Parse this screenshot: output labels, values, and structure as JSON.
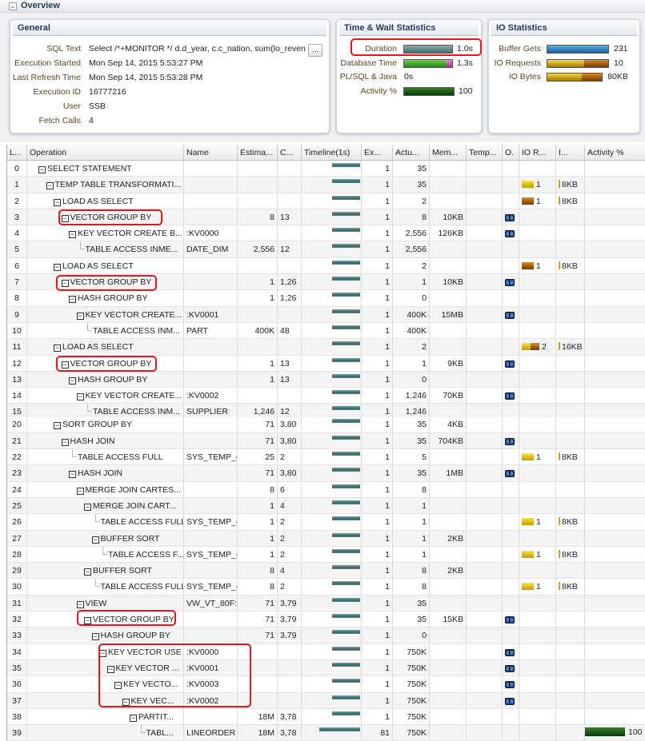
{
  "overview": {
    "title": "Overview"
  },
  "general": {
    "title": "General",
    "more_label": "...",
    "fields": [
      {
        "label": "SQL Text",
        "value": "Select /*+MONITOR */ d.d_year, c.c_nation, sum(lo_reven"
      },
      {
        "label": "Execution Started",
        "value": "Mon Sep 14, 2015 5:53:27 PM"
      },
      {
        "label": "Last Refresh Time",
        "value": "Mon Sep 14, 2015 5:53:28 PM"
      },
      {
        "label": "Execution ID",
        "value": "16777216"
      },
      {
        "label": "User",
        "value": "SSB"
      },
      {
        "label": "Fetch Calls",
        "value": "4"
      }
    ]
  },
  "time_wait": {
    "title": "Time & Wait Statistics",
    "stats": [
      {
        "label": "Duration",
        "value": "1.0s",
        "bar": 1.0
      },
      {
        "label": "Database Time",
        "value": "1.3s",
        "bar": 1.0
      },
      {
        "label": "PL/SQL & Java",
        "value": "0s",
        "bar": 0
      },
      {
        "label": "Activity %",
        "value": "100",
        "bar": 1.0
      }
    ]
  },
  "io": {
    "title": "IO Statistics",
    "stats": [
      {
        "label": "Buffer Gets",
        "value": "231",
        "bar": 1.0
      },
      {
        "label": "IO Requests",
        "value": "10",
        "bar": 1.0
      },
      {
        "label": "IO Bytes",
        "value": "80KB",
        "bar": 0.9
      }
    ]
  },
  "colors": {
    "highlight": "#e8161b",
    "timeline": "#356565",
    "activity": "#0a3a0a"
  },
  "columns": [
    "L...",
    "Operation",
    "Name",
    "Estima...",
    "C...",
    "Timeline(1s)",
    "Ex...",
    "Actu...",
    "Mem...",
    "Temp...",
    "O.",
    "IO R...",
    "I...",
    "Activity %"
  ],
  "rows": [
    {
      "id": "0",
      "lvl": 0,
      "op": "SELECT STATEMENT",
      "name": "",
      "est": "",
      "cost": "",
      "ex": "1",
      "act": "35",
      "mem": "",
      "bino": false,
      "io": "",
      "iot": "",
      "ib": ""
    },
    {
      "id": "1",
      "lvl": 1,
      "op": "TEMP TABLE TRANSFORMATI...",
      "name": "",
      "est": "",
      "cost": "",
      "ex": "1",
      "act": "35",
      "mem": "",
      "bino": false,
      "io": "1",
      "iot": "y",
      "ib": "8KB"
    },
    {
      "id": "2",
      "lvl": 2,
      "op": "LOAD AS SELECT",
      "name": "",
      "est": "",
      "cost": "",
      "ex": "1",
      "act": "2",
      "mem": "",
      "bino": false,
      "io": "1",
      "iot": "b",
      "ib": "8KB"
    },
    {
      "id": "3",
      "lvl": 3,
      "op": "VECTOR GROUP BY",
      "name": "",
      "est": "8",
      "cost": "13",
      "ex": "1",
      "act": "8",
      "mem": "10KB",
      "bino": true,
      "io": "",
      "iot": "",
      "ib": ""
    },
    {
      "id": "4",
      "lvl": 4,
      "op": "KEY VECTOR CREATE B...",
      "name": ":KV0000",
      "est": "",
      "cost": "",
      "ex": "1",
      "act": "2,556",
      "mem": "126KB",
      "bino": true,
      "io": "",
      "iot": "",
      "ib": ""
    },
    {
      "id": "5",
      "lvl": 5,
      "leaf": true,
      "op": "TABLE ACCESS INME...",
      "name": "DATE_DIM",
      "est": "2,556",
      "cost": "12",
      "ex": "1",
      "act": "2,556",
      "mem": "",
      "bino": false,
      "io": "",
      "iot": "",
      "ib": ""
    },
    {
      "id": "6",
      "lvl": 2,
      "op": "LOAD AS SELECT",
      "name": "",
      "est": "",
      "cost": "",
      "ex": "1",
      "act": "2",
      "mem": "",
      "bino": false,
      "io": "1",
      "iot": "b",
      "ib": "8KB"
    },
    {
      "id": "7",
      "lvl": 3,
      "op": "VECTOR GROUP BY",
      "name": "",
      "est": "1",
      "cost": "1,26",
      "ex": "1",
      "act": "1",
      "mem": "10KB",
      "bino": true,
      "io": "",
      "iot": "",
      "ib": ""
    },
    {
      "id": "8",
      "lvl": 4,
      "op": "HASH GROUP BY",
      "name": "",
      "est": "1",
      "cost": "1,26",
      "ex": "1",
      "act": "0",
      "mem": "",
      "bino": false,
      "io": "",
      "iot": "",
      "ib": ""
    },
    {
      "id": "9",
      "lvl": 5,
      "op": "KEY VECTOR CREATE...",
      "name": ":KV0001",
      "est": "",
      "cost": "",
      "ex": "1",
      "act": "400K",
      "mem": "15MB",
      "bino": true,
      "io": "",
      "iot": "",
      "ib": ""
    },
    {
      "id": "10",
      "lvl": 6,
      "leaf": true,
      "op": "TABLE ACCESS INM...",
      "name": "PART",
      "est": "400K",
      "cost": "48",
      "ex": "1",
      "act": "400K",
      "mem": "",
      "bino": false,
      "io": "",
      "iot": "",
      "ib": ""
    },
    {
      "id": "11",
      "lvl": 2,
      "op": "LOAD AS SELECT",
      "name": "",
      "est": "",
      "cost": "",
      "ex": "1",
      "act": "2",
      "mem": "",
      "bino": false,
      "io": "2",
      "iot": "yb",
      "ib": "16KB"
    },
    {
      "id": "12",
      "lvl": 3,
      "op": "VECTOR GROUP BY",
      "name": "",
      "est": "1",
      "cost": "13",
      "ex": "1",
      "act": "1",
      "mem": "9KB",
      "bino": true,
      "io": "",
      "iot": "",
      "ib": ""
    },
    {
      "id": "13",
      "lvl": 4,
      "op": "HASH GROUP BY",
      "name": "",
      "est": "1",
      "cost": "13",
      "ex": "1",
      "act": "0",
      "mem": "",
      "bino": false,
      "io": "",
      "iot": "",
      "ib": ""
    },
    {
      "id": "14",
      "lvl": 5,
      "op": "KEY VECTOR CREATE...",
      "name": ":KV0002",
      "est": "",
      "cost": "",
      "ex": "1",
      "act": "1,246",
      "mem": "70KB",
      "bino": true,
      "io": "",
      "iot": "",
      "ib": ""
    },
    {
      "id": "15",
      "lvl": 6,
      "leaf": true,
      "cut": true,
      "op": "TABLE ACCESS INM...",
      "name": "SUPPLIER",
      "est": "1,246",
      "cost": "12",
      "ex": "1",
      "act": "1,246",
      "mem": "",
      "bino": false,
      "io": "",
      "iot": "",
      "ib": ""
    },
    {
      "id": "20",
      "lvl": 2,
      "op": "SORT GROUP BY",
      "name": "",
      "est": "71",
      "cost": "3,80",
      "ex": "1",
      "act": "35",
      "mem": "4KB",
      "bino": false,
      "io": "",
      "iot": "",
      "ib": ""
    },
    {
      "id": "21",
      "lvl": 3,
      "op": "HASH JOIN",
      "name": "",
      "est": "71",
      "cost": "3,80",
      "ex": "1",
      "act": "35",
      "mem": "704KB",
      "bino": true,
      "io": "",
      "iot": "",
      "ib": ""
    },
    {
      "id": "22",
      "lvl": 4,
      "leaf": true,
      "op": "TABLE ACCESS FULL",
      "name": "SYS_TEMP_(",
      "est": "25",
      "cost": "2",
      "ex": "1",
      "act": "5",
      "mem": "",
      "bino": false,
      "io": "1",
      "iot": "y",
      "ib": "8KB"
    },
    {
      "id": "23",
      "lvl": 4,
      "op": "HASH JOIN",
      "name": "",
      "est": "71",
      "cost": "3,80",
      "ex": "1",
      "act": "35",
      "mem": "1MB",
      "bino": true,
      "io": "",
      "iot": "",
      "ib": ""
    },
    {
      "id": "24",
      "lvl": 5,
      "op": "MERGE JOIN CARTES...",
      "name": "",
      "est": "8",
      "cost": "6",
      "ex": "1",
      "act": "8",
      "mem": "",
      "bino": false,
      "io": "",
      "iot": "",
      "ib": ""
    },
    {
      "id": "25",
      "lvl": 6,
      "op": "MERGE JOIN CART...",
      "name": "",
      "est": "1",
      "cost": "4",
      "ex": "1",
      "act": "1",
      "mem": "",
      "bino": false,
      "io": "",
      "iot": "",
      "ib": ""
    },
    {
      "id": "26",
      "lvl": 7,
      "leaf": true,
      "op": "TABLE ACCESS FULL",
      "name": "SYS_TEMP_(",
      "est": "1",
      "cost": "2",
      "ex": "1",
      "act": "1",
      "mem": "",
      "bino": false,
      "io": "1",
      "iot": "y",
      "ib": "8KB"
    },
    {
      "id": "27",
      "lvl": 7,
      "op": "BUFFER SORT",
      "name": "",
      "est": "1",
      "cost": "2",
      "ex": "1",
      "act": "1",
      "mem": "2KB",
      "bino": false,
      "io": "",
      "iot": "",
      "ib": ""
    },
    {
      "id": "28",
      "lvl": 8,
      "leaf": true,
      "op": "TABLE ACCESS F...",
      "name": "SYS_TEMP_(",
      "est": "1",
      "cost": "2",
      "ex": "1",
      "act": "1",
      "mem": "",
      "bino": false,
      "io": "1",
      "iot": "y",
      "ib": "8KB"
    },
    {
      "id": "29",
      "lvl": 6,
      "op": "BUFFER SORT",
      "name": "",
      "est": "8",
      "cost": "4",
      "ex": "1",
      "act": "8",
      "mem": "2KB",
      "bino": false,
      "io": "",
      "iot": "",
      "ib": ""
    },
    {
      "id": "30",
      "lvl": 7,
      "leaf": true,
      "op": "TABLE ACCESS FULL",
      "name": "SYS_TEMP_(",
      "est": "8",
      "cost": "2",
      "ex": "1",
      "act": "8",
      "mem": "",
      "bino": false,
      "io": "1",
      "iot": "y",
      "ib": "8KB"
    },
    {
      "id": "31",
      "lvl": 5,
      "op": "VIEW",
      "name": "VW_VT_80F:",
      "est": "71",
      "cost": "3,79",
      "ex": "1",
      "act": "35",
      "mem": "",
      "bino": false,
      "io": "",
      "iot": "",
      "ib": ""
    },
    {
      "id": "32",
      "lvl": 6,
      "op": "VECTOR GROUP BY",
      "name": "",
      "est": "71",
      "cost": "3,79",
      "ex": "1",
      "act": "35",
      "mem": "15KB",
      "bino": true,
      "io": "",
      "iot": "",
      "ib": ""
    },
    {
      "id": "33",
      "lvl": 7,
      "op": "HASH GROUP BY",
      "name": "",
      "est": "71",
      "cost": "3,79",
      "ex": "1",
      "act": "0",
      "mem": "",
      "bino": false,
      "io": "",
      "iot": "",
      "ib": ""
    },
    {
      "id": "34",
      "lvl": 8,
      "op": "KEY VECTOR USE",
      "name": ":KV0000",
      "est": "",
      "cost": "",
      "ex": "1",
      "act": "750K",
      "mem": "",
      "bino": true,
      "io": "",
      "iot": "",
      "ib": ""
    },
    {
      "id": "35",
      "lvl": 9,
      "op": "KEY VECTOR ...",
      "name": ":KV0001",
      "est": "",
      "cost": "",
      "ex": "1",
      "act": "750K",
      "mem": "",
      "bino": true,
      "io": "",
      "iot": "",
      "ib": ""
    },
    {
      "id": "36",
      "lvl": 10,
      "op": "KEY VECTO...",
      "name": ":KV0003",
      "est": "",
      "cost": "",
      "ex": "1",
      "act": "750K",
      "mem": "",
      "bino": true,
      "io": "",
      "iot": "",
      "ib": ""
    },
    {
      "id": "37",
      "lvl": 11,
      "op": "KEY VEC...",
      "name": ":KV0002",
      "est": "",
      "cost": "",
      "ex": "1",
      "act": "750K",
      "mem": "",
      "bino": true,
      "io": "",
      "iot": "",
      "ib": ""
    },
    {
      "id": "38",
      "lvl": 12,
      "op": "PARTIT...",
      "name": "",
      "est": "18M",
      "cost": "3,78",
      "ex": "1",
      "act": "750K",
      "mem": "",
      "bino": false,
      "io": "",
      "iot": "",
      "ib": ""
    },
    {
      "id": "39",
      "lvl": 13,
      "leaf": true,
      "wide": true,
      "op": "TABL...",
      "name": "LINEORDER",
      "est": "18M",
      "cost": "3,78",
      "ex": "81",
      "act": "750K",
      "mem": "",
      "bino": false,
      "io": "",
      "iot": "",
      "ib": "",
      "activity": "100"
    }
  ]
}
